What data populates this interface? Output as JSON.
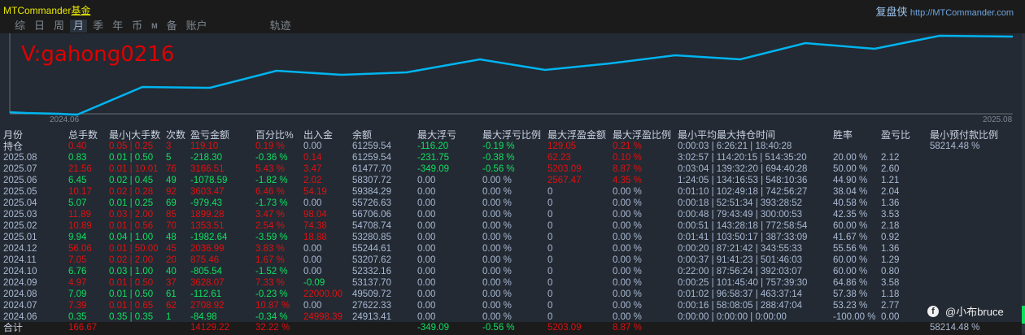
{
  "app": {
    "brand": "MTCommander",
    "brand_suffix": "基金",
    "site_name": "复盘侠",
    "site_url": "http://MTCommander.com"
  },
  "tabs": [
    "综",
    "日",
    "周",
    "月",
    "季",
    "年",
    "币",
    "M",
    "备",
    "账户",
    "轨迹"
  ],
  "active_tab": "月",
  "chart": {
    "watermark": "V:gahong0216",
    "x_start": "2024.06",
    "x_end": "2025.08",
    "line_color": "#00b4f0"
  },
  "columns": [
    "月份",
    "总手数",
    "最小|大手数",
    "次数",
    "盈亏金额",
    "百分比%",
    "出入金",
    "余额",
    "最大浮亏",
    "最大浮亏比例",
    "最大浮盈金额",
    "最大浮盈比例",
    "最小平均最大持仓时间",
    "胜率",
    "盈亏比",
    "最小预付款比例"
  ],
  "rows": [
    [
      "持仓",
      "0.40",
      "0.05 | 0.25",
      "3",
      "119.10",
      "0.19 %",
      "0.00",
      "61259.54",
      "-116.20",
      "-0.19 %",
      "129.05",
      "0.21 %",
      "0:00:03 | 6:26:21 | 18:40:28",
      "",
      "",
      "58214.48 %"
    ],
    [
      "2025.08",
      "0.83",
      "0.01 | 0.50",
      "5",
      "-218.30",
      "-0.36 %",
      "0.14",
      "61259.54",
      "-231.75",
      "-0.38 %",
      "62.23",
      "0.10 %",
      "3:02:57 | 114:20:15 | 514:35:20",
      "20.00 %",
      "2.12",
      ""
    ],
    [
      "2025.07",
      "21.56",
      "0.01 | 10.01",
      "76",
      "3166.51",
      "5.43 %",
      "3.47",
      "61477.70",
      "-349.09",
      "-0.56 %",
      "5203.09",
      "8.87 %",
      "0:03:04 | 139:32:20 | 694:40:28",
      "50.00 %",
      "2.60",
      ""
    ],
    [
      "2025.06",
      "6.45",
      "0.02 | 0.45",
      "49",
      "-1078.59",
      "-1.82 %",
      "2.02",
      "58307.72",
      "0.00",
      "0.00 %",
      "2567.47",
      "4.35 %",
      "1:24:05 | 134:16:53 | 548:10:36",
      "44.90 %",
      "1.21",
      ""
    ],
    [
      "2025.05",
      "10.17",
      "0.02 | 0.28",
      "92",
      "3603.47",
      "6.46 %",
      "54.19",
      "59384.29",
      "0.00",
      "0.00 %",
      "0",
      "0.00 %",
      "0:01:10 | 102:49:18 | 742:56:27",
      "38.04 %",
      "2.04",
      ""
    ],
    [
      "2025.04",
      "5.07",
      "0.01 | 0.25",
      "69",
      "-979.43",
      "-1.73 %",
      "0.00",
      "55726.63",
      "0.00",
      "0.00 %",
      "0",
      "0.00 %",
      "0:00:18 | 52:51:34 | 393:28:52",
      "40.58 %",
      "1.36",
      ""
    ],
    [
      "2025.03",
      "11.89",
      "0.03 | 2.00",
      "85",
      "1899.28",
      "3.47 %",
      "98.04",
      "56706.06",
      "0.00",
      "0.00 %",
      "0",
      "0.00 %",
      "0:00:48 | 79:43:49 | 300:00:53",
      "42.35 %",
      "3.53",
      ""
    ],
    [
      "2025.02",
      "10.89",
      "0.01 | 0.56",
      "70",
      "1353.51",
      "2.54 %",
      "74.38",
      "54708.74",
      "0.00",
      "0.00 %",
      "0",
      "0.00 %",
      "0:00:51 | 143:28:18 | 772:58:54",
      "60.00 %",
      "2.18",
      ""
    ],
    [
      "2025.01",
      "9.94",
      "0.04 | 1.00",
      "48",
      "-1982.64",
      "-3.59 %",
      "18.88",
      "53280.85",
      "0.00",
      "0.00 %",
      "0",
      "0.00 %",
      "0:01:41 | 103:50:17 | 387:33:09",
      "41.67 %",
      "0.92",
      ""
    ],
    [
      "2024.12",
      "56.06",
      "0.01 | 50.00",
      "45",
      "2036.99",
      "3.83 %",
      "0.00",
      "55244.61",
      "0.00",
      "0.00 %",
      "0",
      "0.00 %",
      "0:00:20 | 87:21:42 | 343:55:33",
      "55.56 %",
      "1.36",
      ""
    ],
    [
      "2024.11",
      "7.05",
      "0.02 | 2.00",
      "20",
      "875.46",
      "1.67 %",
      "0.00",
      "53207.62",
      "0.00",
      "0.00 %",
      "0",
      "0.00 %",
      "0:00:37 | 91:41:23 | 501:46:03",
      "60.00 %",
      "1.29",
      ""
    ],
    [
      "2024.10",
      "6.76",
      "0.03 | 1.00",
      "40",
      "-805.54",
      "-1.52 %",
      "0.00",
      "52332.16",
      "0.00",
      "0.00 %",
      "0",
      "0.00 %",
      "0:22:00 | 87:56:24 | 392:03:07",
      "60.00 %",
      "0.80",
      ""
    ],
    [
      "2024.09",
      "4.97",
      "0.01 | 0.50",
      "37",
      "3628.07",
      "7.33 %",
      "-0.09",
      "53137.70",
      "0.00",
      "0.00 %",
      "0",
      "0.00 %",
      "0:00:25 | 101:45:40 | 757:39:30",
      "64.86 %",
      "3.58",
      ""
    ],
    [
      "2024.08",
      "7.09",
      "0.01 | 0.50",
      "61",
      "-112.61",
      "-0.23 %",
      "22000.00",
      "49509.72",
      "0.00",
      "0.00 %",
      "0",
      "0.00 %",
      "0:01:02 | 96:58:37 | 463:37:14",
      "57.38 %",
      "1.18",
      ""
    ],
    [
      "2024.07",
      "7.39",
      "0.01 | 0.65",
      "62",
      "2708.92",
      "10.87 %",
      "0.00",
      "27622.33",
      "0.00",
      "0.00 %",
      "0",
      "0.00 %",
      "0:00:16 | 58:08:05 | 288:47:04",
      "53.23 %",
      "2.77",
      ""
    ],
    [
      "2024.06",
      "0.35",
      "0.35 | 0.35",
      "1",
      "-84.98",
      "-0.34 %",
      "24998.39",
      "24913.41",
      "0.00",
      "0.00 %",
      "0",
      "0.00 %",
      "0:00:00 | 0:00:00 | 0:00:00",
      "-100.00 %",
      "0.00",
      ""
    ]
  ],
  "total": [
    "合计",
    "166.67",
    "",
    "",
    "14129.22",
    "32.22 %",
    "",
    "",
    "-349.09",
    "-0.56 %",
    "5203.09",
    "8.87 %",
    "",
    "",
    "",
    "58214.48 %"
  ],
  "social": {
    "handle": "@小布bruce"
  },
  "colors": {
    "red": "#e01010",
    "green": "#10e060",
    "text": "#a9b9d3"
  }
}
